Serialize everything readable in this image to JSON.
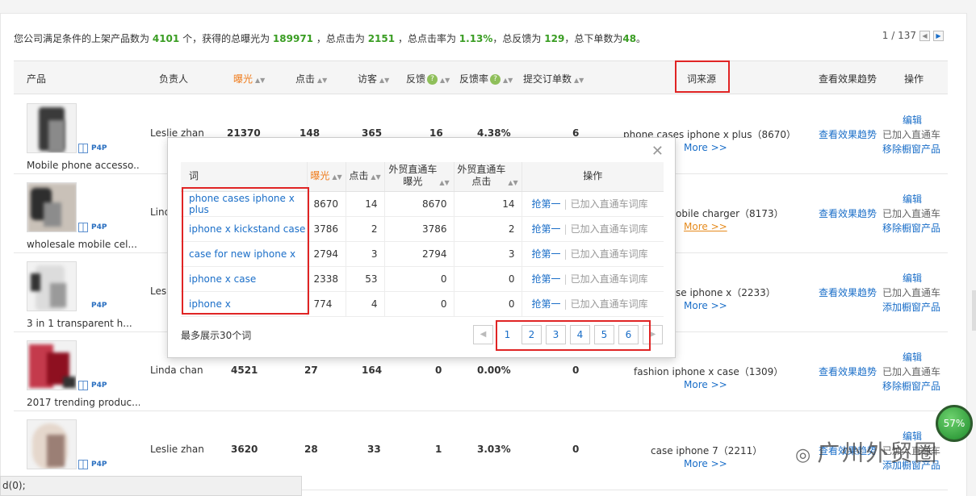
{
  "summary": {
    "p1": "您公司满足条件的上架产品数为",
    "products": "4101",
    "p2": "个，获得的总曝光为",
    "exposure": "189971",
    "p3": "，总点击为",
    "clicks": "2151",
    "p4": "，总点击率为",
    "ctr": "1.13%",
    "p5": "，总反馈为",
    "feedback": "129",
    "p6": "，总下单数为",
    "orders": "48",
    "p7": "。"
  },
  "pager_top": {
    "text": "1 / 137",
    "prev": "◀",
    "next": "▶"
  },
  "columns": {
    "product": "产品",
    "owner": "负责人",
    "exposure": "曝光",
    "clicks": "点击",
    "visitors": "访客",
    "feedback": "反馈",
    "feedback_rate": "反馈率",
    "orders": "提交订单数",
    "word_source": "词来源",
    "trend": "查看效果趋势",
    "ops": "操作"
  },
  "p4p_label": "P4P",
  "rows": [
    {
      "name": "Mobile phone accesso...",
      "owner": "Leslie zhan",
      "exposure": "21370",
      "clicks": "148",
      "visitors": "365",
      "feedback": "16",
      "rate": "4.38%",
      "orders": "6",
      "word": "phone cases iphone x plus（8670）",
      "more": "More >>",
      "trend": "查看效果趋势",
      "edit": "编辑",
      "added": "已加入直通车",
      "action": "移除橱窗产品"
    },
    {
      "name": "wholesale mobile cel...",
      "owner": "Lind",
      "exposure": "",
      "clicks": "",
      "visitors": "",
      "feedback": "",
      "rate": "",
      "orders": "",
      "word": "obile charger（8173）",
      "more": "More >>",
      "trend": "查看效果趋势",
      "edit": "编辑",
      "added": "已加入直通车",
      "action": "移除橱窗产品"
    },
    {
      "name": "3 in 1 transparent h...",
      "owner": "Lesl",
      "exposure": "",
      "clicks": "",
      "visitors": "",
      "feedback": "",
      "rate": "",
      "orders": "",
      "word": "se iphone x（2233）",
      "more": "More >>",
      "trend": "查看效果趋势",
      "edit": "编辑",
      "added": "已加入直通车",
      "action": "添加橱窗产品"
    },
    {
      "name": "2017 trending produc...",
      "owner": "Linda chan",
      "exposure": "4521",
      "clicks": "27",
      "visitors": "164",
      "feedback": "0",
      "rate": "0.00%",
      "orders": "0",
      "word": "fashion iphone x case（1309）",
      "more": "More >>",
      "trend": "查看效果趋势",
      "edit": "编辑",
      "added": "已加入直通车",
      "action": "移除橱窗产品"
    },
    {
      "name": "",
      "owner": "Leslie zhan",
      "exposure": "3620",
      "clicks": "28",
      "visitors": "33",
      "feedback": "1",
      "rate": "3.03%",
      "orders": "0",
      "word": "case iphone 7（2211）",
      "more": "More >>",
      "trend": "查看效果趋势",
      "edit": "编辑",
      "added": "已加入直通车",
      "action": "添加橱窗产品"
    }
  ],
  "popup": {
    "close": "✕",
    "headers": {
      "word": "词",
      "exposure": "曝光",
      "clicks": "点击",
      "p4p_exposure": "外贸直通车\n曝光",
      "p4p_clicks": "外贸直通车\n点击",
      "ops": "操作"
    },
    "rows": [
      {
        "word": "phone cases iphone x plus",
        "exposure": "8670",
        "clicks": "14",
        "p4p_exposure": "8670",
        "p4p_clicks": "14",
        "grab": "抢第一",
        "added": "已加入直通车词库"
      },
      {
        "word": "iphone x kickstand case",
        "exposure": "3786",
        "clicks": "2",
        "p4p_exposure": "3786",
        "p4p_clicks": "2",
        "grab": "抢第一",
        "added": "已加入直通车词库"
      },
      {
        "word": "case for new iphone x",
        "exposure": "2794",
        "clicks": "3",
        "p4p_exposure": "2794",
        "p4p_clicks": "3",
        "grab": "抢第一",
        "added": "已加入直通车词库"
      },
      {
        "word": "iphone x case",
        "exposure": "2338",
        "clicks": "53",
        "p4p_exposure": "0",
        "p4p_clicks": "0",
        "grab": "抢第一",
        "added": "已加入直通车词库"
      },
      {
        "word": "iphone x",
        "exposure": "774",
        "clicks": "4",
        "p4p_exposure": "0",
        "p4p_clicks": "0",
        "grab": "抢第一",
        "added": "已加入直通车词库"
      }
    ],
    "max_note": "最多展示30个词",
    "pages": [
      "1",
      "2",
      "3",
      "4",
      "5",
      "6"
    ],
    "prev": "◀",
    "next": "▶"
  },
  "status_bar": "d(0);",
  "badge": "57%",
  "watermark": "广州外贸圈",
  "colors": {
    "accent_green": "#3a9d23",
    "link_blue": "#1a6ec8",
    "highlight_red": "#e02424",
    "sort_orange": "#f07c1c"
  }
}
